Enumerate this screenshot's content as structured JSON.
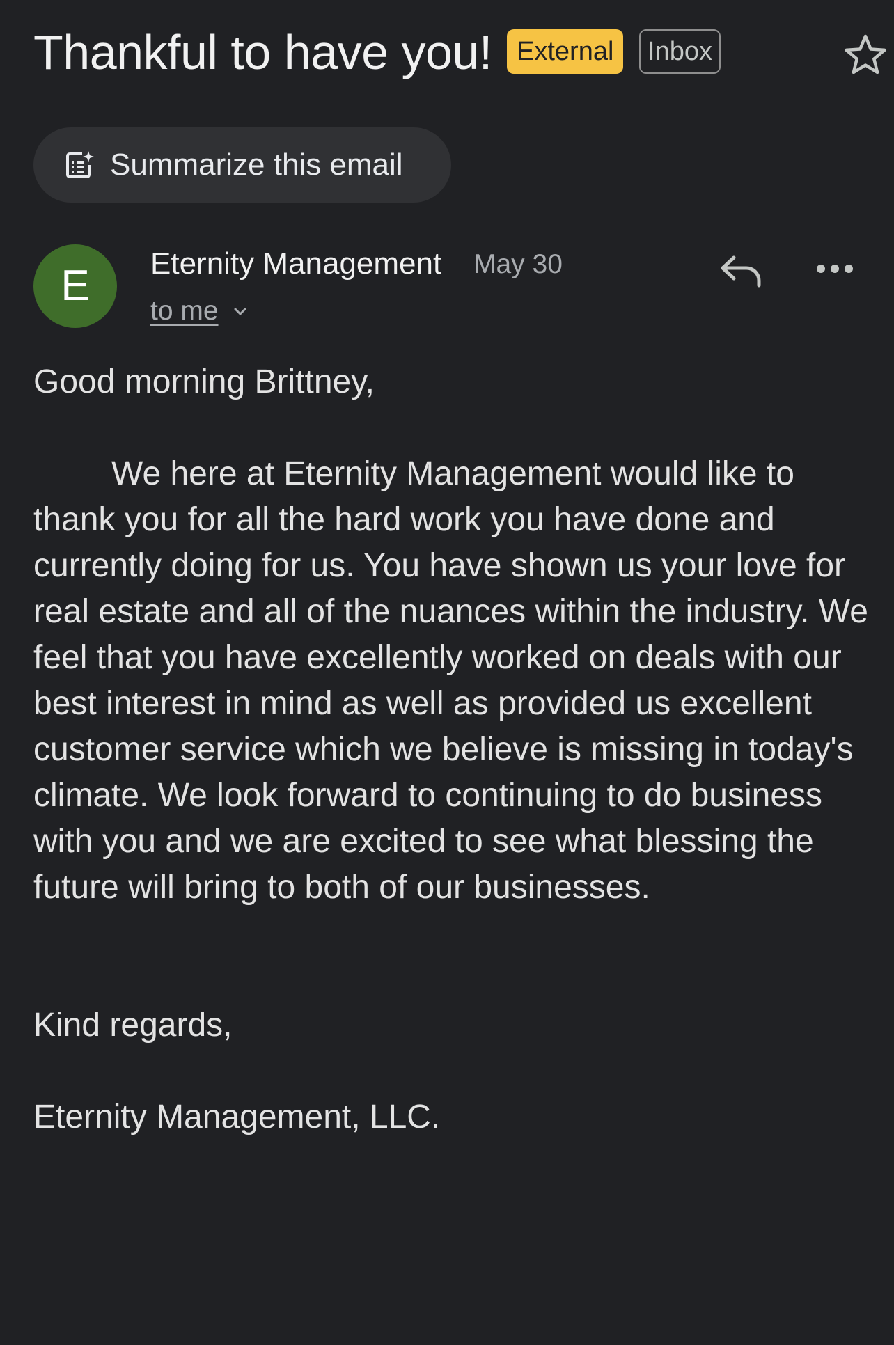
{
  "email": {
    "subject": "Thankful to have you!",
    "labels": {
      "external": "External",
      "inbox": "Inbox"
    },
    "summarize_label": "Summarize this email",
    "sender": {
      "initial": "E",
      "name": "Eternity Management",
      "date": "May 30",
      "recipient": "to me",
      "avatar_color": "#3f6d2a"
    },
    "body": {
      "greeting": "Good morning Brittney,",
      "paragraph": "We here at Eternity Management would like to thank you for all the hard work you have done and currently doing for us. You have shown us your love for real estate and all of the nuances within the industry. We feel that you have excellently worked on deals with our best interest in mind as well as provided us excellent customer service which we believe is missing in today's climate. We look forward to continuing to do business with you and we are excited to see what blessing the future will bring to both of our businesses.",
      "closing": "Kind regards,",
      "signature": "Eternity Management, LLC."
    }
  },
  "icons": {
    "star": "star-icon",
    "summarize": "summarize-icon",
    "reply": "reply-icon",
    "more": "more-icon",
    "expand": "chevron-down-icon"
  },
  "colors": {
    "background": "#202124",
    "external_label": "#f6c344",
    "button_background": "#303134"
  }
}
